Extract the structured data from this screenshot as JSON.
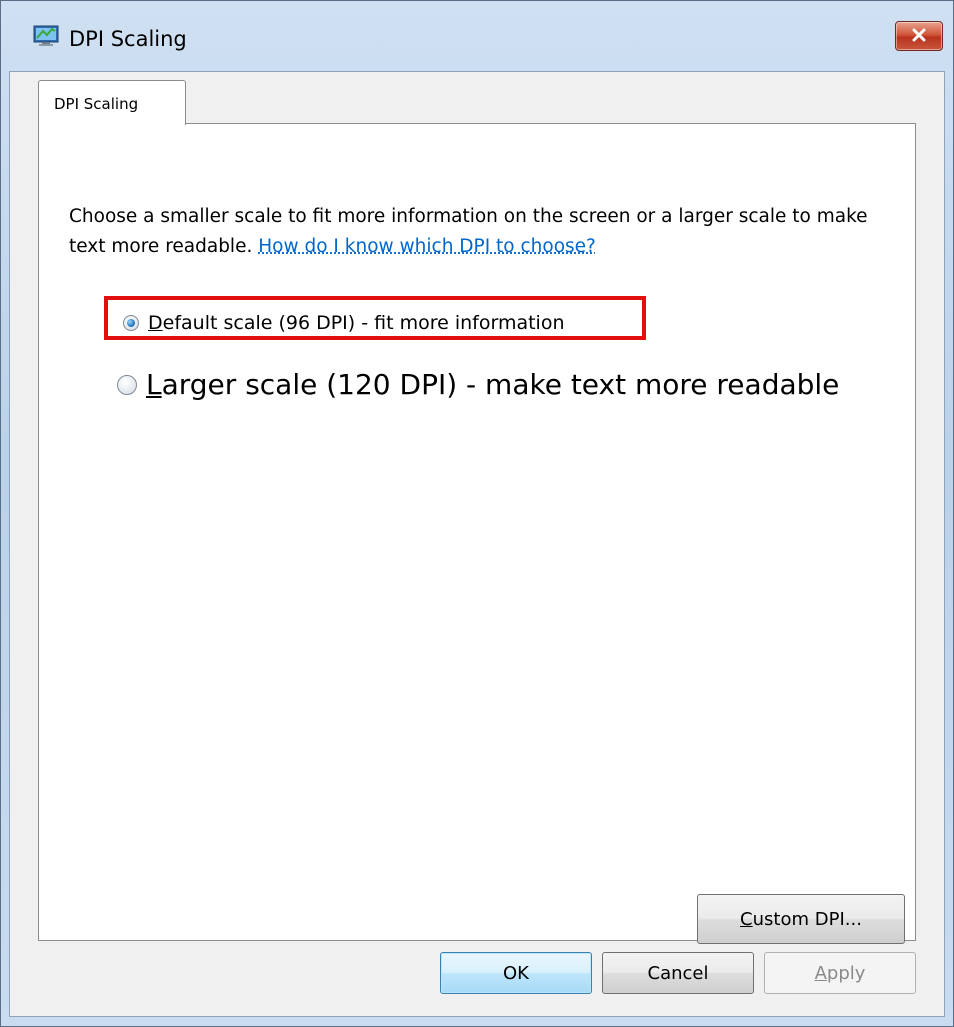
{
  "window": {
    "title": "DPI Scaling",
    "icon": "monitor-icon",
    "close_icon": "close-icon",
    "close_color": "#c9573e"
  },
  "tabs": [
    {
      "label": "DPI Scaling"
    }
  ],
  "description": {
    "text": "Choose a smaller scale to fit more information on the screen or a larger scale to make text more readable.",
    "link": "How do I know which DPI to choose?"
  },
  "options": [
    {
      "mnemonic": "D",
      "rest": "efault scale (96 DPI) - fit more information",
      "selected": true
    },
    {
      "mnemonic": "L",
      "rest": "arger scale (120 DPI) - make text more readable",
      "selected": false
    }
  ],
  "buttons": {
    "custom": {
      "mnemonic": "C",
      "rest": "ustom DPI..."
    },
    "ok": {
      "label": "OK"
    },
    "cancel": {
      "label": "Cancel"
    },
    "apply": {
      "mnemonic": "A",
      "rest": "pply",
      "enabled": false
    }
  },
  "highlight_color": "#e01010"
}
